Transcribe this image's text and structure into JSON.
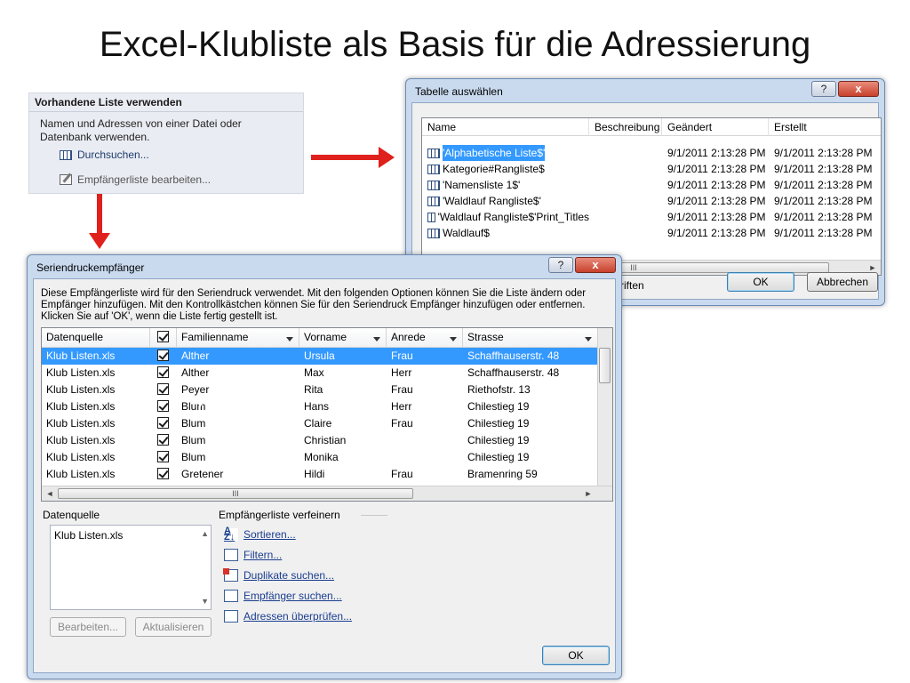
{
  "slide": {
    "title": "Excel-Klubliste als Basis für die Adressierung"
  },
  "ribbon_panel": {
    "heading": "Vorhandene Liste verwenden",
    "description": "Namen und Adressen von einer Datei oder Datenbank verwenden.",
    "browse_label": "Durchsuchen...",
    "edit_list_label": "Empfängerliste bearbeiten..."
  },
  "table_dialog": {
    "title": "Tabelle auswählen",
    "help_label": "?",
    "close_label": "x",
    "columns": [
      "Name",
      "Beschreibung",
      "Geändert",
      "Erstellt"
    ],
    "rows": [
      {
        "name": "'Alphabetische Liste$'",
        "description": "",
        "modified": "9/1/2011 2:13:28 PM",
        "created": "9/1/2011 2:13:28 PM"
      },
      {
        "name": "Kategorie#Rangliste$",
        "description": "",
        "modified": "9/1/2011 2:13:28 PM",
        "created": "9/1/2011 2:13:28 PM"
      },
      {
        "name": "'Namensliste 1$'",
        "description": "",
        "modified": "9/1/2011 2:13:28 PM",
        "created": "9/1/2011 2:13:28 PM"
      },
      {
        "name": "'Waldlauf Rangliste$'",
        "description": "",
        "modified": "9/1/2011 2:13:28 PM",
        "created": "9/1/2011 2:13:28 PM"
      },
      {
        "name": "'Waldlauf Rangliste$'Print_Titles",
        "description": "",
        "modified": "9/1/2011 2:13:28 PM",
        "created": "9/1/2011 2:13:28 PM"
      },
      {
        "name": "Waldlauf$",
        "description": "",
        "modified": "9/1/2011 2:13:28 PM",
        "created": "9/1/2011 2:13:28 PM"
      }
    ],
    "scroll_thumb_label": "III",
    "partial_text": "riften",
    "ok_label": "OK",
    "cancel_label": "Abbrechen"
  },
  "merge_dialog": {
    "title": "Seriendruckempfänger",
    "help_label": "?",
    "close_label": "x",
    "description": "Diese Empfängerliste wird für den Seriendruck verwendet. Mit den folgenden Optionen können Sie die Liste ändern oder Empfänger hinzufügen. Mit den Kontrollkästchen können Sie für den Seriendruck Empfänger hinzufügen oder entfernen. Klicken Sie auf 'OK', wenn die Liste fertig gestellt ist.",
    "columns": [
      "Datenquelle",
      "",
      "Familienname",
      "Vorname",
      "Anrede",
      "Strasse"
    ],
    "rows": [
      {
        "source": "Klub Listen.xls",
        "last": "Alther",
        "first": "Ursula",
        "salutation": "Frau",
        "street": "Schaffhauserstr. 48"
      },
      {
        "source": "Klub Listen.xls",
        "last": "Alther",
        "first": "Max",
        "salutation": "Herr",
        "street": "Schaffhauserstr. 48"
      },
      {
        "source": "Klub Listen.xls",
        "last": "Peyer",
        "first": "Rita",
        "salutation": "Frau",
        "street": "Riethofstr. 13"
      },
      {
        "source": "Klub Listen.xls",
        "last": "Blum",
        "first": "Hans",
        "salutation": "Herr",
        "street": "Chilestieg 19"
      },
      {
        "source": "Klub Listen.xls",
        "last": "Blum",
        "first": "Claire",
        "salutation": "Frau",
        "street": "Chilestieg 19"
      },
      {
        "source": "Klub Listen.xls",
        "last": "Blum",
        "first": "Christian",
        "salutation": "",
        "street": "Chilestieg 19"
      },
      {
        "source": "Klub Listen.xls",
        "last": "Blum",
        "first": "Monika",
        "salutation": "",
        "street": "Chilestieg 19"
      },
      {
        "source": "Klub Listen.xls",
        "last": "Gretener",
        "first": "Hildi",
        "salutation": "Frau",
        "street": "Bramenring 59"
      }
    ],
    "scroll_thumb_label": "III",
    "datasource_heading": "Datenquelle",
    "datasource_items": [
      "Klub Listen.xls"
    ],
    "edit_label": "Bearbeiten...",
    "refresh_label": "Aktualisieren",
    "refine_heading": "Empfängerliste verfeinern",
    "refine_links": [
      "Sortieren...",
      "Filtern...",
      "Duplikate suchen...",
      "Empfänger suchen...",
      "Adressen überprüfen..."
    ],
    "ok_label": "OK"
  }
}
